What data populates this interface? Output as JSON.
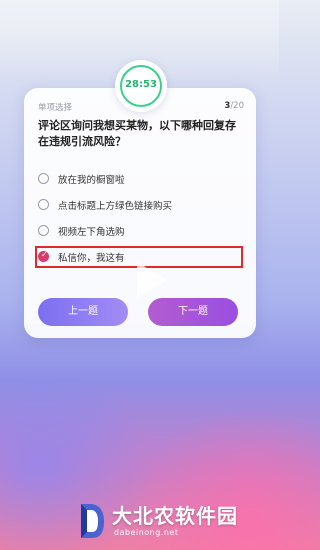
{
  "timer": {
    "value": "28:53"
  },
  "card": {
    "type_label": "单项选择",
    "progress_current": "3",
    "progress_total": "/20",
    "question": "评论区询问我想买某物，以下哪种回复存在违规引流风险？"
  },
  "options": [
    {
      "text": "放在我的橱窗啦",
      "selected": false
    },
    {
      "text": "点击标题上方绿色链接购买",
      "selected": false
    },
    {
      "text": "视频左下角选购",
      "selected": false
    },
    {
      "text": "私信你，我这有",
      "selected": true
    }
  ],
  "buttons": {
    "prev": "上一题",
    "next": "下一题"
  },
  "watermark": {
    "title": "大北农软件园",
    "url": "dabeinong.net"
  },
  "colors": {
    "accent_green": "#22b46e",
    "selected_red": "#e02a2a",
    "radio_selected": "#d8396e"
  }
}
